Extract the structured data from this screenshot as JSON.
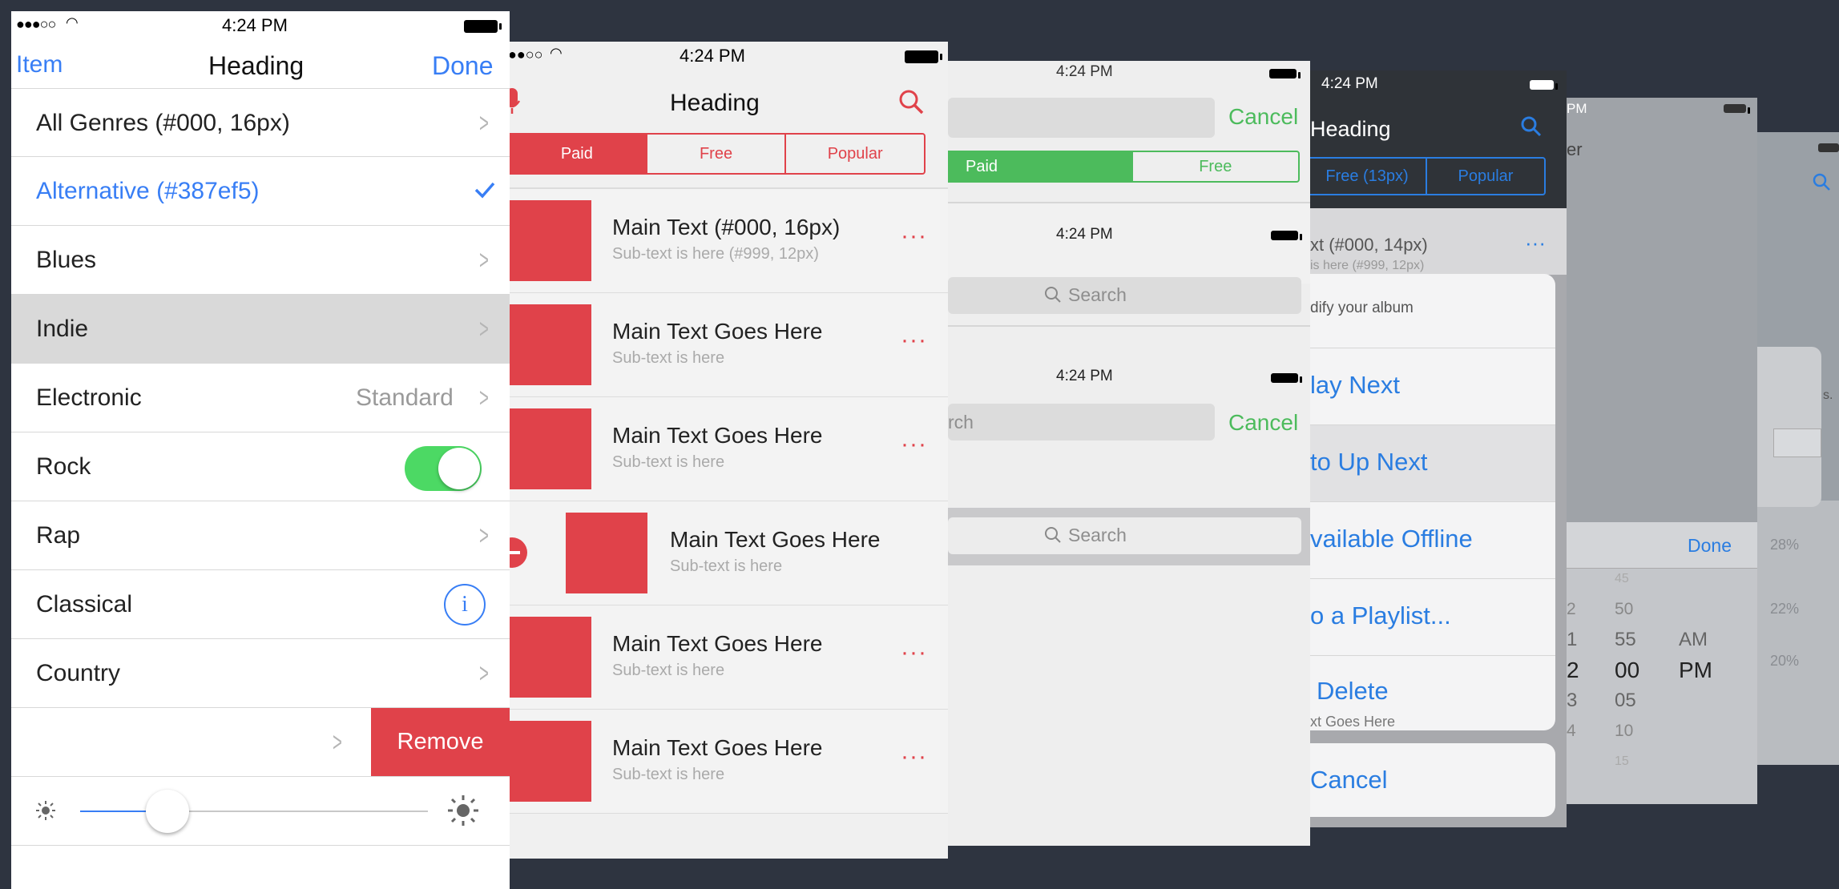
{
  "screen1": {
    "status": {
      "signal": "●●●○○",
      "time": "4:24 PM"
    },
    "nav": {
      "left": "Item",
      "title": "Heading",
      "right": "Done"
    },
    "rows": [
      {
        "label": "All Genres (#000, 16px)"
      },
      {
        "label": "Alternative (#387ef5)"
      },
      {
        "label": "Blues"
      },
      {
        "label": "Indie"
      },
      {
        "label": "Electronic",
        "value": "Standard"
      },
      {
        "label": "Rock"
      },
      {
        "label": "Rap"
      },
      {
        "label": "Classical"
      },
      {
        "label": "Country"
      }
    ],
    "remove_label": "Remove",
    "slider_level": 0.25,
    "colors": {
      "accent": "#387ef5",
      "toggle": "#4cd964",
      "danger": "#e0424a"
    }
  },
  "screen2": {
    "status": {
      "signal": "●●○○",
      "time": "4:24 PM"
    },
    "title": "Heading",
    "tabs": [
      "Paid",
      "Free",
      "Popular"
    ],
    "items": [
      {
        "main": "Main Text (#000, 16px)",
        "sub": "Sub-text is here  (#999, 12px)"
      },
      {
        "main": "Main Text Goes Here",
        "sub": "Sub-text is here"
      },
      {
        "main": "Main Text Goes Here",
        "sub": "Sub-text is here"
      },
      {
        "main": "Main Text Goes Here",
        "sub": "Sub-text is here"
      },
      {
        "main": "Main Text Goes Here",
        "sub": "Sub-text is here"
      },
      {
        "main": "Main Text Goes Here",
        "sub": "Sub-text is here"
      }
    ],
    "colors": {
      "accent": "#e0424a"
    }
  },
  "screen3": {
    "time": "4:24 PM",
    "cancel1": "Cancel",
    "tabs": [
      "Paid",
      "Free"
    ],
    "time2": "4:24 PM",
    "search_placeholder": "Search",
    "time3": "4:24 PM",
    "partial_search": "rch",
    "cancel2": "Cancel",
    "search2": "Search",
    "colors": {
      "accent": "#4cbb5c"
    }
  },
  "screen4": {
    "time": "4:24 PM",
    "title": "Heading",
    "tabs": [
      "Free (13px)",
      "Popular"
    ],
    "row_main": "xt (#000, 14px)",
    "row_sub": "is here  (#999, 12px)",
    "sheet_title": "dify your album",
    "actions": [
      "lay Next",
      "to Up Next",
      "vailable Offline",
      "o a Playlist...",
      "Delete"
    ],
    "cancel": "Cancel",
    "behind_text": "xt Goes Here",
    "colors": {
      "accent": "#2a7de1"
    }
  },
  "screen5": {
    "time": "PM",
    "title": "er",
    "done": "Done",
    "picker": [
      {
        "h": "",
        "m": "45",
        "ap": ""
      },
      {
        "h": "2",
        "m": "50",
        "ap": ""
      },
      {
        "h": "1",
        "m": "55",
        "ap": "AM"
      },
      {
        "h": "2",
        "m": "00",
        "ap": "PM"
      },
      {
        "h": "3",
        "m": "05",
        "ap": ""
      },
      {
        "h": "4",
        "m": "10",
        "ap": ""
      },
      {
        "h": "",
        "m": "15",
        "ap": ""
      }
    ]
  },
  "screen6": {
    "percents": [
      "28%",
      "22%",
      "20%"
    ],
    "edge_marks": [
      "%",
      "%",
      "s.",
      "%"
    ]
  }
}
